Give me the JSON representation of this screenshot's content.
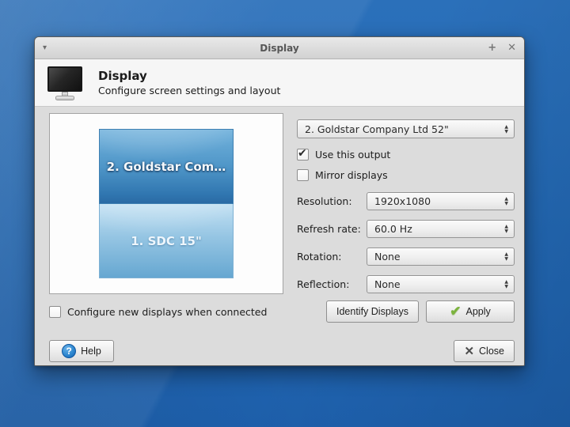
{
  "titlebar": {
    "title": "Display",
    "menu_icon": "▾",
    "maximize_icon": "+",
    "close_icon": "✕"
  },
  "header": {
    "title": "Display",
    "subtitle": "Configure screen settings and layout"
  },
  "preview": {
    "monitors": [
      {
        "label": "2. Goldstar Com…"
      },
      {
        "label": "1. SDC 15\""
      }
    ]
  },
  "panel": {
    "display_select": {
      "value": "2. Goldstar Company Ltd 52\""
    },
    "use_output": {
      "label": "Use this output",
      "checked": true
    },
    "mirror": {
      "label": "Mirror displays",
      "checked": false
    },
    "rows": [
      {
        "label": "Resolution:",
        "value": "1920x1080"
      },
      {
        "label": "Refresh rate:",
        "value": "60.0 Hz"
      },
      {
        "label": "Rotation:",
        "value": "None"
      },
      {
        "label": "Reflection:",
        "value": "None"
      }
    ]
  },
  "actions": {
    "configure_new": {
      "label": "Configure new displays when connected",
      "checked": false
    },
    "identify_label": "Identify Displays",
    "apply_label": "Apply"
  },
  "footer": {
    "help_label": "Help",
    "close_label": "Close"
  },
  "icons": {
    "check": "✔",
    "apply_check": "✔",
    "close_x": "✕",
    "help_q": "?",
    "spin_up": "▲",
    "spin_down": "▼"
  },
  "colors": {
    "desktop_blue": "#2268b4",
    "dialog_gray": "#dcdcdc",
    "monitor_selected_top": "#72b2dc",
    "monitor_selected_bottom": "#2a6aa4",
    "monitor_other_top": "#c3e1f3",
    "monitor_other_bottom": "#66a7d1",
    "apply_green": "#7cb33e",
    "help_blue": "#2f88d0"
  }
}
